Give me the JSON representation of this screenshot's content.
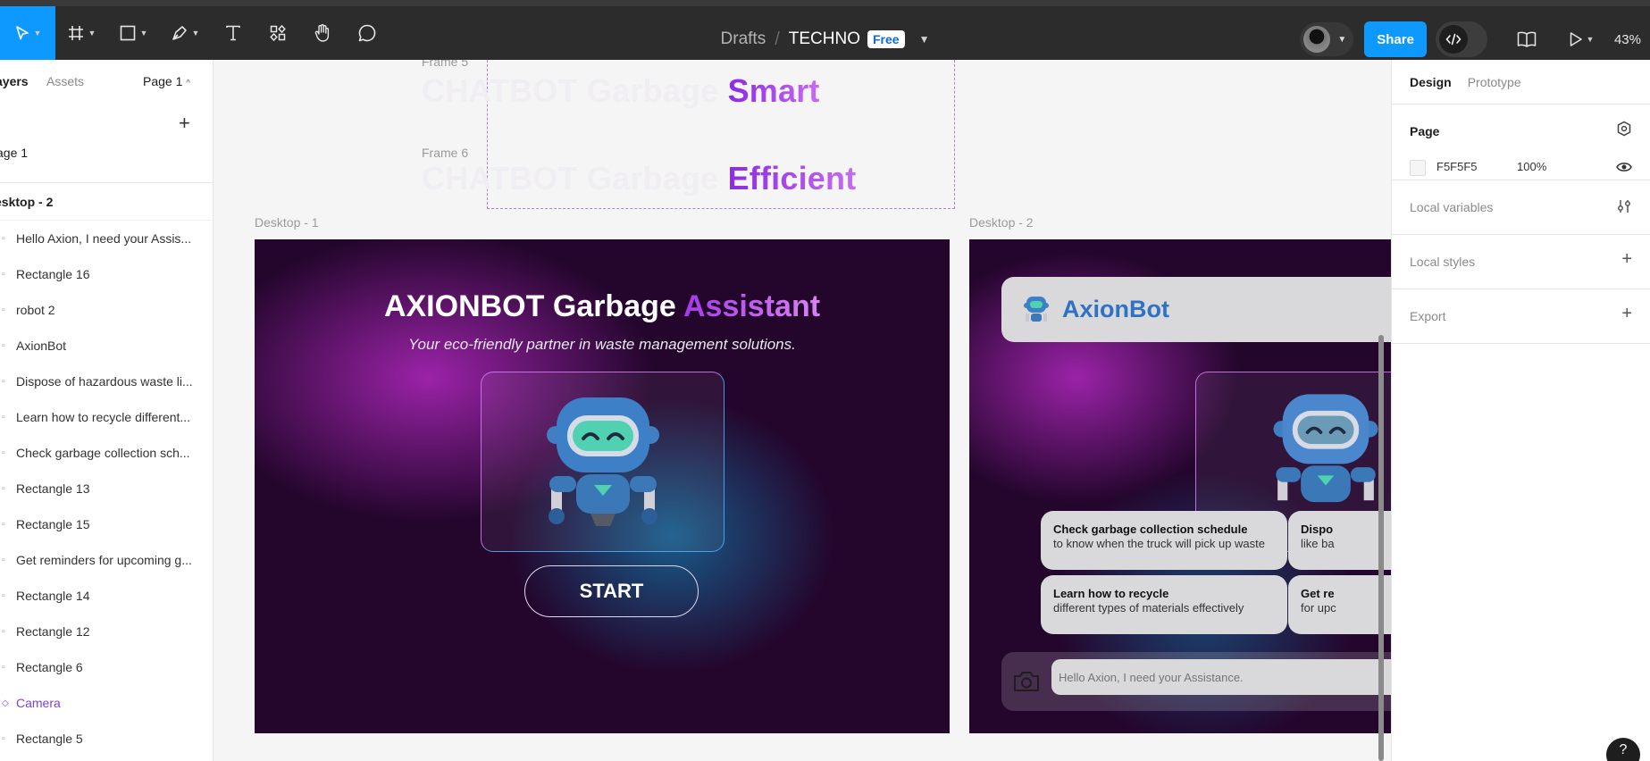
{
  "toolbar": {
    "breadcrumb_drafts": "Drafts",
    "breadcrumb_sep": "/",
    "file_name": "TECHNO",
    "plan_badge": "Free",
    "share_label": "Share",
    "zoom": "43%"
  },
  "left_panel": {
    "tab_layers": "ayers",
    "tab_assets": "Assets",
    "page_select": "Page 1",
    "page_item": "age 1",
    "root_layer": "esktop - 2",
    "layers": [
      {
        "label": "Hello Axion, I need your Assis...",
        "purple": false
      },
      {
        "label": "Rectangle 16",
        "purple": false
      },
      {
        "label": "robot 2",
        "purple": false
      },
      {
        "label": "AxionBot",
        "purple": false
      },
      {
        "label": "Dispose of hazardous waste li...",
        "purple": false
      },
      {
        "label": "Learn how to recycle different...",
        "purple": false
      },
      {
        "label": "Check garbage collection sch...",
        "purple": false
      },
      {
        "label": "Rectangle 13",
        "purple": false
      },
      {
        "label": "Rectangle 15",
        "purple": false
      },
      {
        "label": "Get reminders for upcoming g...",
        "purple": false
      },
      {
        "label": "Rectangle 14",
        "purple": false
      },
      {
        "label": "Rectangle 12",
        "purple": false
      },
      {
        "label": "Rectangle 6",
        "purple": false
      },
      {
        "label": "Camera",
        "purple": true
      },
      {
        "label": "Rectangle 5",
        "purple": false
      }
    ]
  },
  "canvas": {
    "frame5_label": "Frame 5",
    "frame5_text": "CHATBOT Garbage ",
    "frame5_highlight": "Smart",
    "frame6_label": "Frame 6",
    "frame6_text": "CHATBOT Garbage ",
    "frame6_highlight": "Efficient",
    "desktop1_label": "Desktop - 1",
    "desktop2_label": "Desktop - 2",
    "desktop1": {
      "title": "AXIONBOT Garbage ",
      "title_highlight": "Assistant",
      "subtitle": "Your eco-friendly partner in waste management solutions.",
      "start_label": "START"
    },
    "desktop2": {
      "brand": "AxionBot",
      "suggestions": [
        {
          "title": "Check garbage collection schedule",
          "sub": "to know when the truck will pick up waste"
        },
        {
          "title": "Dispo",
          "sub": "like ba"
        },
        {
          "title": "Learn how to recycle",
          "sub": "different types of materials effectively"
        },
        {
          "title": "Get re",
          "sub": "for upc"
        }
      ],
      "input_placeholder": "Hello Axion, I need your Assistance."
    }
  },
  "right_panel": {
    "tab_design": "Design",
    "tab_prototype": "Prototype",
    "page_section": "Page",
    "page_color": "F5F5F5",
    "page_opacity": "100%",
    "local_variables": "Local variables",
    "local_styles": "Local styles",
    "export": "Export"
  },
  "colors": {
    "accent": "#0d99ff",
    "toolbar_bg": "#2c2c2c",
    "brand_purple": "#a33be8",
    "brand_blue": "#2e72c4"
  },
  "icons": {
    "move": "move-icon",
    "frame": "frame-icon",
    "shape": "rectangle-icon",
    "pen": "pen-icon",
    "text": "text-icon",
    "components": "components-icon",
    "hand": "hand-icon",
    "comment": "comment-icon",
    "dev_mode": "code-icon",
    "library": "book-icon",
    "present": "play-icon",
    "help": "help-icon"
  }
}
